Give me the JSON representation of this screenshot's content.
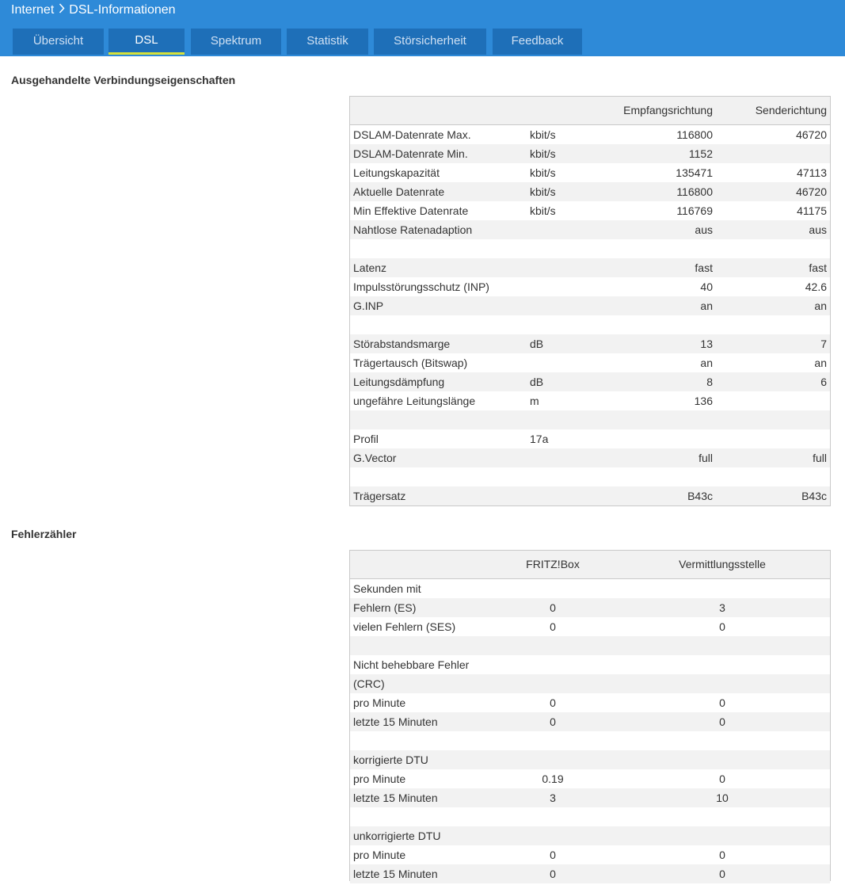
{
  "breadcrumb": {
    "parent": "Internet",
    "current": "DSL-Informationen"
  },
  "tabs": [
    {
      "label": "Übersicht",
      "active": false
    },
    {
      "label": "DSL",
      "active": true
    },
    {
      "label": "Spektrum",
      "active": false
    },
    {
      "label": "Statistik",
      "active": false
    },
    {
      "label": "Störsicherheit",
      "active": false
    },
    {
      "label": "Feedback",
      "active": false
    }
  ],
  "colors": {
    "header": "#2e8ad8",
    "tab": "#1e6fb8",
    "active_underline": "#d5e03a"
  },
  "connection": {
    "title": "Ausgehandelte Verbindungseigenschaften",
    "col_rx": "Empfangsrichtung",
    "col_tx": "Senderichtung",
    "rows": [
      {
        "label": "DSLAM-Datenrate Max.",
        "unit": "kbit/s",
        "rx": "116800",
        "tx": "46720"
      },
      {
        "label": "DSLAM-Datenrate Min.",
        "unit": "kbit/s",
        "rx": "1152",
        "tx": ""
      },
      {
        "label": "Leitungskapazität",
        "unit": "kbit/s",
        "rx": "135471",
        "tx": "47113"
      },
      {
        "label": "Aktuelle Datenrate",
        "unit": "kbit/s",
        "rx": "116800",
        "tx": "46720"
      },
      {
        "label": "Min Effektive Datenrate",
        "unit": "kbit/s",
        "rx": "116769",
        "tx": "41175"
      },
      {
        "label": "Nahtlose Ratenadaption",
        "unit": "",
        "rx": "aus",
        "tx": "aus"
      },
      {
        "label": "",
        "unit": "",
        "rx": "",
        "tx": ""
      },
      {
        "label": "Latenz",
        "unit": "",
        "rx": "fast",
        "tx": "fast"
      },
      {
        "label": "Impulsstörungsschutz (INP)",
        "unit": "",
        "rx": "40",
        "tx": "42.6"
      },
      {
        "label": "G.INP",
        "unit": "",
        "rx": "an",
        "tx": "an"
      },
      {
        "label": "",
        "unit": "",
        "rx": "",
        "tx": ""
      },
      {
        "label": "Störabstandsmarge",
        "unit": "dB",
        "rx": "13",
        "tx": "7"
      },
      {
        "label": "Trägertausch (Bitswap)",
        "unit": "",
        "rx": "an",
        "tx": "an"
      },
      {
        "label": "Leitungsdämpfung",
        "unit": "dB",
        "rx": "8",
        "tx": "6"
      },
      {
        "label": "ungefähre Leitungslänge",
        "unit": "m",
        "rx": "136",
        "tx": ""
      },
      {
        "label": "",
        "unit": "",
        "rx": "",
        "tx": ""
      },
      {
        "label": "Profil",
        "unit": "17a",
        "rx": "",
        "tx": ""
      },
      {
        "label": "G.Vector",
        "unit": "",
        "rx": "full",
        "tx": "full"
      },
      {
        "label": "",
        "unit": "",
        "rx": "",
        "tx": ""
      },
      {
        "label": "Trägersatz",
        "unit": "",
        "rx": "B43c",
        "tx": "B43c"
      }
    ]
  },
  "errors": {
    "title": "Fehlerzähler",
    "col_box": "FRITZ!Box",
    "col_exchange": "Vermittlungsstelle",
    "rows": [
      {
        "label": "Sekunden mit",
        "box": "",
        "exchange": ""
      },
      {
        "label": "Fehlern (ES)",
        "box": "0",
        "exchange": "3"
      },
      {
        "label": "vielen Fehlern (SES)",
        "box": "0",
        "exchange": "0"
      },
      {
        "label": "",
        "box": "",
        "exchange": ""
      },
      {
        "label": "Nicht behebbare Fehler",
        "box": "",
        "exchange": ""
      },
      {
        "label": "(CRC)",
        "box": "",
        "exchange": ""
      },
      {
        "label": "pro Minute",
        "box": "0",
        "exchange": "0"
      },
      {
        "label": "letzte 15 Minuten",
        "box": "0",
        "exchange": "0"
      },
      {
        "label": "",
        "box": "",
        "exchange": ""
      },
      {
        "label": "korrigierte DTU",
        "box": "",
        "exchange": ""
      },
      {
        "label": "pro Minute",
        "box": "0.19",
        "exchange": "0"
      },
      {
        "label": "letzte 15 Minuten",
        "box": "3",
        "exchange": "10"
      },
      {
        "label": "",
        "box": "",
        "exchange": ""
      },
      {
        "label": "unkorrigierte DTU",
        "box": "",
        "exchange": ""
      },
      {
        "label": "pro Minute",
        "box": "0",
        "exchange": "0"
      },
      {
        "label": "letzte 15 Minuten",
        "box": "0",
        "exchange": "0"
      }
    ]
  }
}
